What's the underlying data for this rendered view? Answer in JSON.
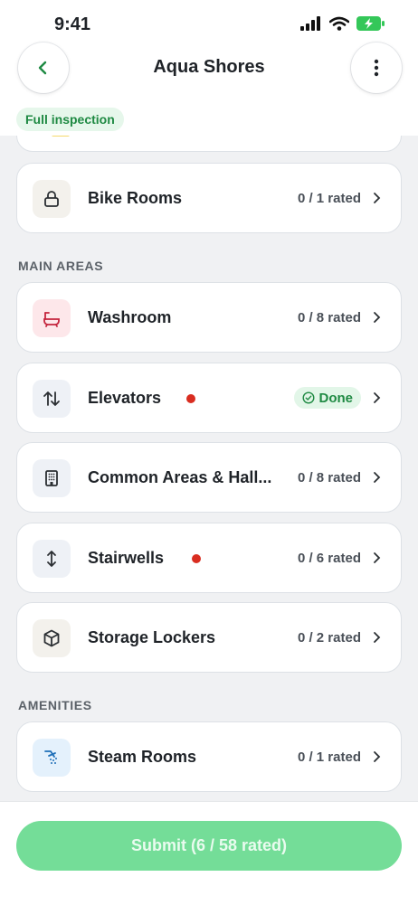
{
  "status_bar": {
    "time": "9:41"
  },
  "header": {
    "title": "Aqua Shores",
    "inspection_type": "Full inspection"
  },
  "sections": {
    "main_areas": "MAIN AREAS",
    "amenities": "AMENITIES"
  },
  "items": {
    "bike_rooms": {
      "label": "Bike Rooms",
      "rated": "0 / 1 rated",
      "icon": "lock-icon"
    },
    "washroom": {
      "label": "Washroom",
      "rated": "0 / 8 rated",
      "icon": "bathtub-icon"
    },
    "elevators": {
      "label": "Elevators",
      "status": "Done",
      "flagged": true,
      "icon": "up-down-arrows-icon"
    },
    "common_areas": {
      "label": "Common Areas & Hall...",
      "rated": "0 / 8 rated",
      "icon": "building-icon"
    },
    "stairwells": {
      "label": "Stairwells",
      "rated": "0 / 6 rated",
      "flagged": true,
      "icon": "vertical-arrows-icon"
    },
    "storage_lockers": {
      "label": "Storage Lockers",
      "rated": "0 / 2 rated",
      "icon": "box-icon"
    },
    "steam_rooms": {
      "label": "Steam Rooms",
      "rated": "0 / 1 rated",
      "icon": "shower-icon"
    }
  },
  "footer": {
    "submit_label": "Submit (6 / 58 rated)"
  },
  "colors": {
    "accent_green": "#1f8a43",
    "submit_bg": "#74dd98",
    "flag_red": "#d92d20"
  }
}
